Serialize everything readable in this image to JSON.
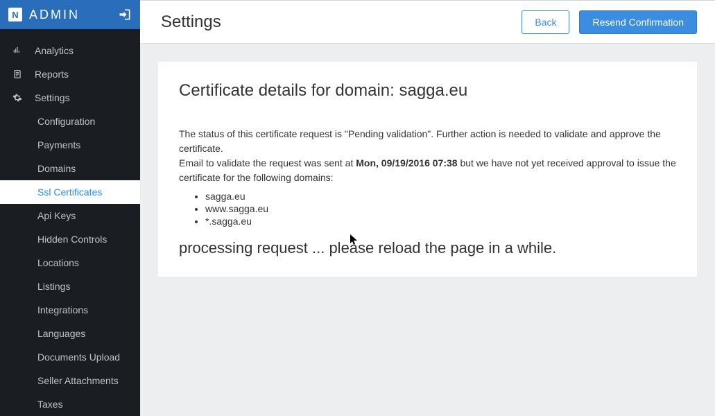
{
  "brand": {
    "logo_letter": "N",
    "label": "ADMIN"
  },
  "nav": {
    "items": [
      {
        "label": "Analytics"
      },
      {
        "label": "Reports"
      },
      {
        "label": "Settings"
      }
    ],
    "settings_sub": [
      "Configuration",
      "Payments",
      "Domains",
      "Ssl Certificates",
      "Api Keys",
      "Hidden Controls",
      "Locations",
      "Listings",
      "Integrations",
      "Languages",
      "Documents Upload",
      "Seller Attachments",
      "Taxes"
    ],
    "active_sub_index": 3
  },
  "topbar": {
    "title": "Settings",
    "back": "Back",
    "resend": "Resend Confirmation"
  },
  "card": {
    "title": "Certificate details for domain: sagga.eu",
    "status_line": "The status of this certificate request is \"Pending validation\". Further action is needed to validate and approve the certificate.",
    "email_prefix": "Email to validate the request was sent at ",
    "email_time": "Mon, 09/19/2016 07:38",
    "email_suffix": " but we have not yet received approval to issue the certificate for the following domains:",
    "domains": [
      "sagga.eu",
      "www.sagga.eu",
      "*.sagga.eu"
    ],
    "processing": "processing request ... please reload the page in a while."
  }
}
